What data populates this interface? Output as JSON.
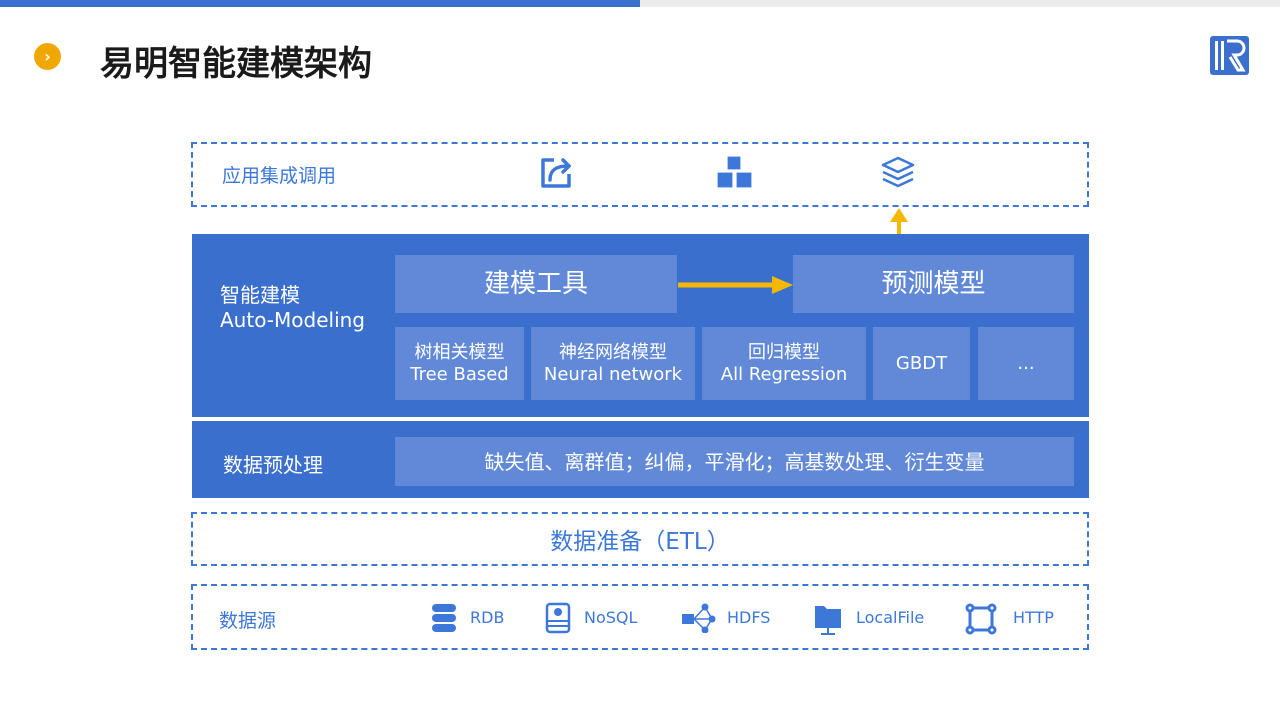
{
  "header": {
    "title": "易明智能建模架构",
    "progress": 0.5,
    "bullet_icon": "chevron-right-icon",
    "logo_icon": "logo-r-icon"
  },
  "app_layer": {
    "label": "应用集成调用",
    "icons": [
      "share-icon",
      "cubes-icon",
      "layers-icon"
    ]
  },
  "modeling": {
    "label_cn": "智能建模",
    "label_en": "Auto-Modeling",
    "tool": "建模工具",
    "model": "预测模型",
    "algorithms": [
      {
        "cn": "树相关模型",
        "en": "Tree Based"
      },
      {
        "cn": "神经网络模型",
        "en": "Neural network"
      },
      {
        "cn": "回归模型",
        "en": "All Regression"
      },
      {
        "cn": "",
        "en": "GBDT"
      },
      {
        "cn": "",
        "en": "..."
      }
    ]
  },
  "preprocess": {
    "label": "数据预处理",
    "content": "缺失值、离群值；纠偏，平滑化；高基数处理、衍生变量"
  },
  "etl": {
    "label": "数据准备（ETL）"
  },
  "datasource": {
    "label": "数据源",
    "items": [
      {
        "name": "RDB",
        "icon": "database-icon"
      },
      {
        "name": "NoSQL",
        "icon": "server-icon"
      },
      {
        "name": "HDFS",
        "icon": "network-icon"
      },
      {
        "name": "LocalFile",
        "icon": "folder-icon"
      },
      {
        "name": "HTTP",
        "icon": "connection-icon"
      }
    ]
  },
  "colors": {
    "primary": "#3b6fce",
    "inner": "#6189d8",
    "accent": "#f5b800",
    "dash": "#3d78d8"
  }
}
